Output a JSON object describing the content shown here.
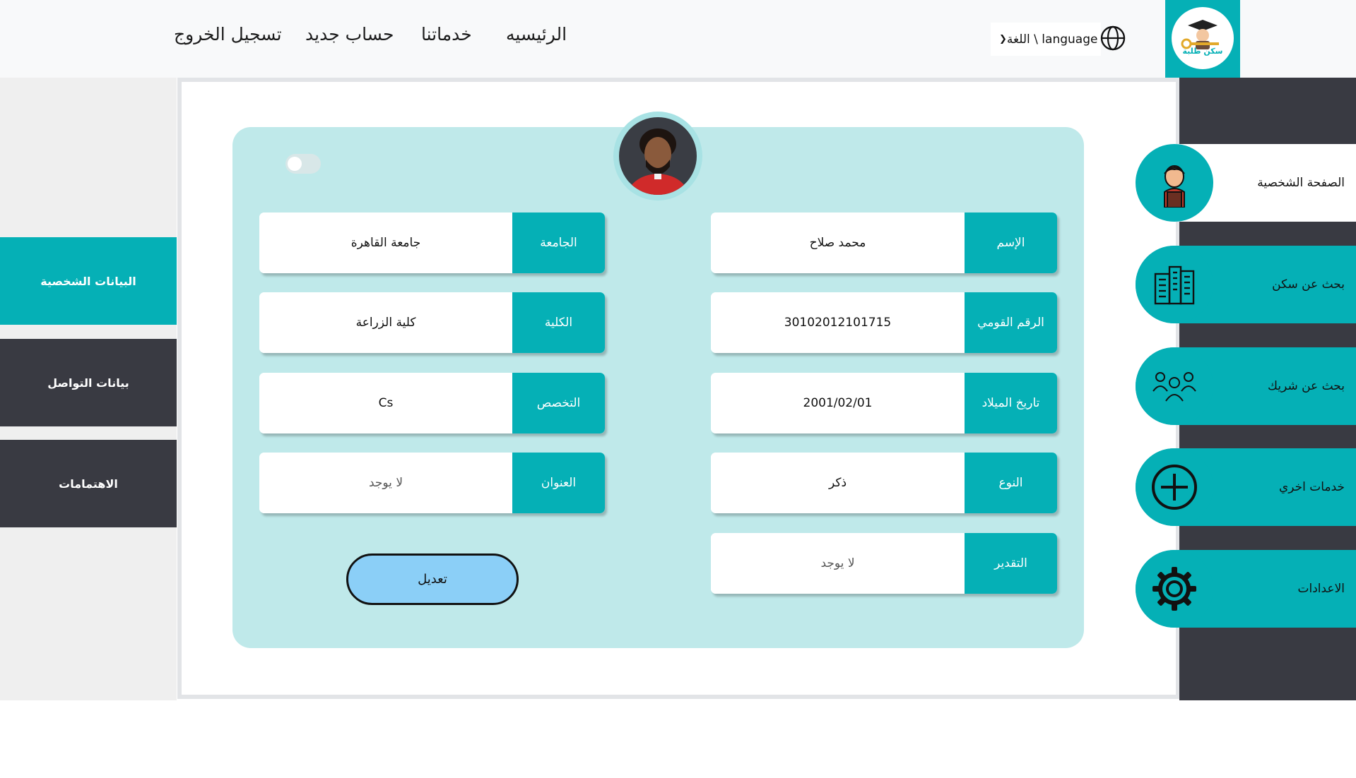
{
  "header": {
    "nav": [
      "الرئيسيه",
      "خدماتنا",
      "حساب جديد",
      "تسجيل الخروج"
    ],
    "language_label": "اللغة \\ language",
    "logo_text": "سكن طلبة",
    "logo_subtext": "STUDENT HOUSING"
  },
  "left_tabs": [
    {
      "label": "البيانات الشخصية",
      "active": true
    },
    {
      "label": "بيانات التواصل",
      "active": false
    },
    {
      "label": "الاهتمامات",
      "active": false
    }
  ],
  "profile": {
    "right_column": [
      {
        "label": "الإسم",
        "value": "محمد صلاح"
      },
      {
        "label": "الرقم القومي",
        "value": "30102012101715"
      },
      {
        "label": "تاريخ الميلاد",
        "value": "2001/02/01"
      },
      {
        "label": "النوع",
        "value": "ذكر"
      },
      {
        "label": "التقدير",
        "value": "لا يوجد"
      }
    ],
    "left_column": [
      {
        "label": "الجامعة",
        "value": "جامعة القاهرة"
      },
      {
        "label": "الكلية",
        "value": "كلية الزراعة"
      },
      {
        "label": "التخصص",
        "value": "Cs"
      },
      {
        "label": "العنوان",
        "value": "لا يوجد"
      }
    ],
    "edit_label": "تعديل"
  },
  "sidebar": [
    {
      "label": "الصفحة الشخصية",
      "icon": "student-profile-icon",
      "active": true
    },
    {
      "label": "بحث عن سكن",
      "icon": "building-icon",
      "active": false
    },
    {
      "label": "بحث عن شريك",
      "icon": "people-group-icon",
      "active": false
    },
    {
      "label": "خدمات اخري",
      "icon": "plus-circle-icon",
      "active": false
    },
    {
      "label": "الاعدادات",
      "icon": "gear-icon",
      "active": false
    }
  ],
  "colors": {
    "accent": "#05b0b6",
    "dark": "#393a42",
    "card": "#bfe9ea",
    "button": "#8bcff7"
  }
}
